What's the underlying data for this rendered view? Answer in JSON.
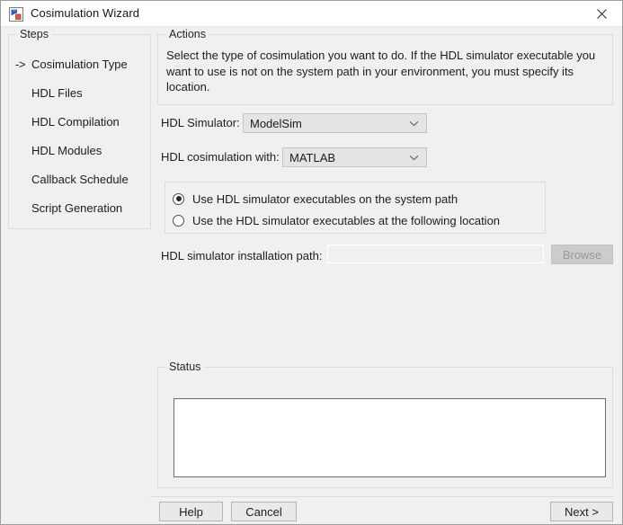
{
  "window": {
    "title": "Cosimulation Wizard",
    "icon": "cosimulation-wizard-icon",
    "close_label": "close-icon"
  },
  "steps": {
    "group_title": "Steps",
    "current_marker": "->",
    "items": [
      {
        "label": "Cosimulation Type",
        "current": true
      },
      {
        "label": "HDL Files",
        "current": false
      },
      {
        "label": "HDL Compilation",
        "current": false
      },
      {
        "label": "HDL Modules",
        "current": false
      },
      {
        "label": "Callback Schedule",
        "current": false
      },
      {
        "label": "Script Generation",
        "current": false
      }
    ]
  },
  "actions": {
    "group_title": "Actions",
    "description": "Select the type of cosimulation you want to do. If the HDL simulator executable you want to use is not on the system path in your environment, you must specify its location."
  },
  "form": {
    "simulator_label": "HDL Simulator:",
    "simulator_value": "ModelSim",
    "simulator_options": [
      "ModelSim"
    ],
    "cosim_label": "HDL cosimulation with:",
    "cosim_value": "MATLAB",
    "cosim_options": [
      "MATLAB"
    ],
    "radio_options": [
      {
        "label": "Use HDL simulator executables on the system path",
        "selected": true
      },
      {
        "label": "Use the HDL simulator executables at the following location",
        "selected": false
      }
    ],
    "path_label": "HDL simulator installation path:",
    "path_value": "",
    "path_placeholder": "",
    "browse_label": "Browse"
  },
  "status": {
    "group_title": "Status",
    "text": "",
    "placeholder": ""
  },
  "footer": {
    "help_label": "Help",
    "cancel_label": "Cancel",
    "next_label": "Next >"
  },
  "colors": {
    "window_bg": "#f0f0f0",
    "titlebar_bg": "#ffffff",
    "group_border": "#dcdcdc",
    "field_bg": "#e4e4e4",
    "text": "#1c1c1c",
    "disabled_text": "#9a9a9a"
  }
}
